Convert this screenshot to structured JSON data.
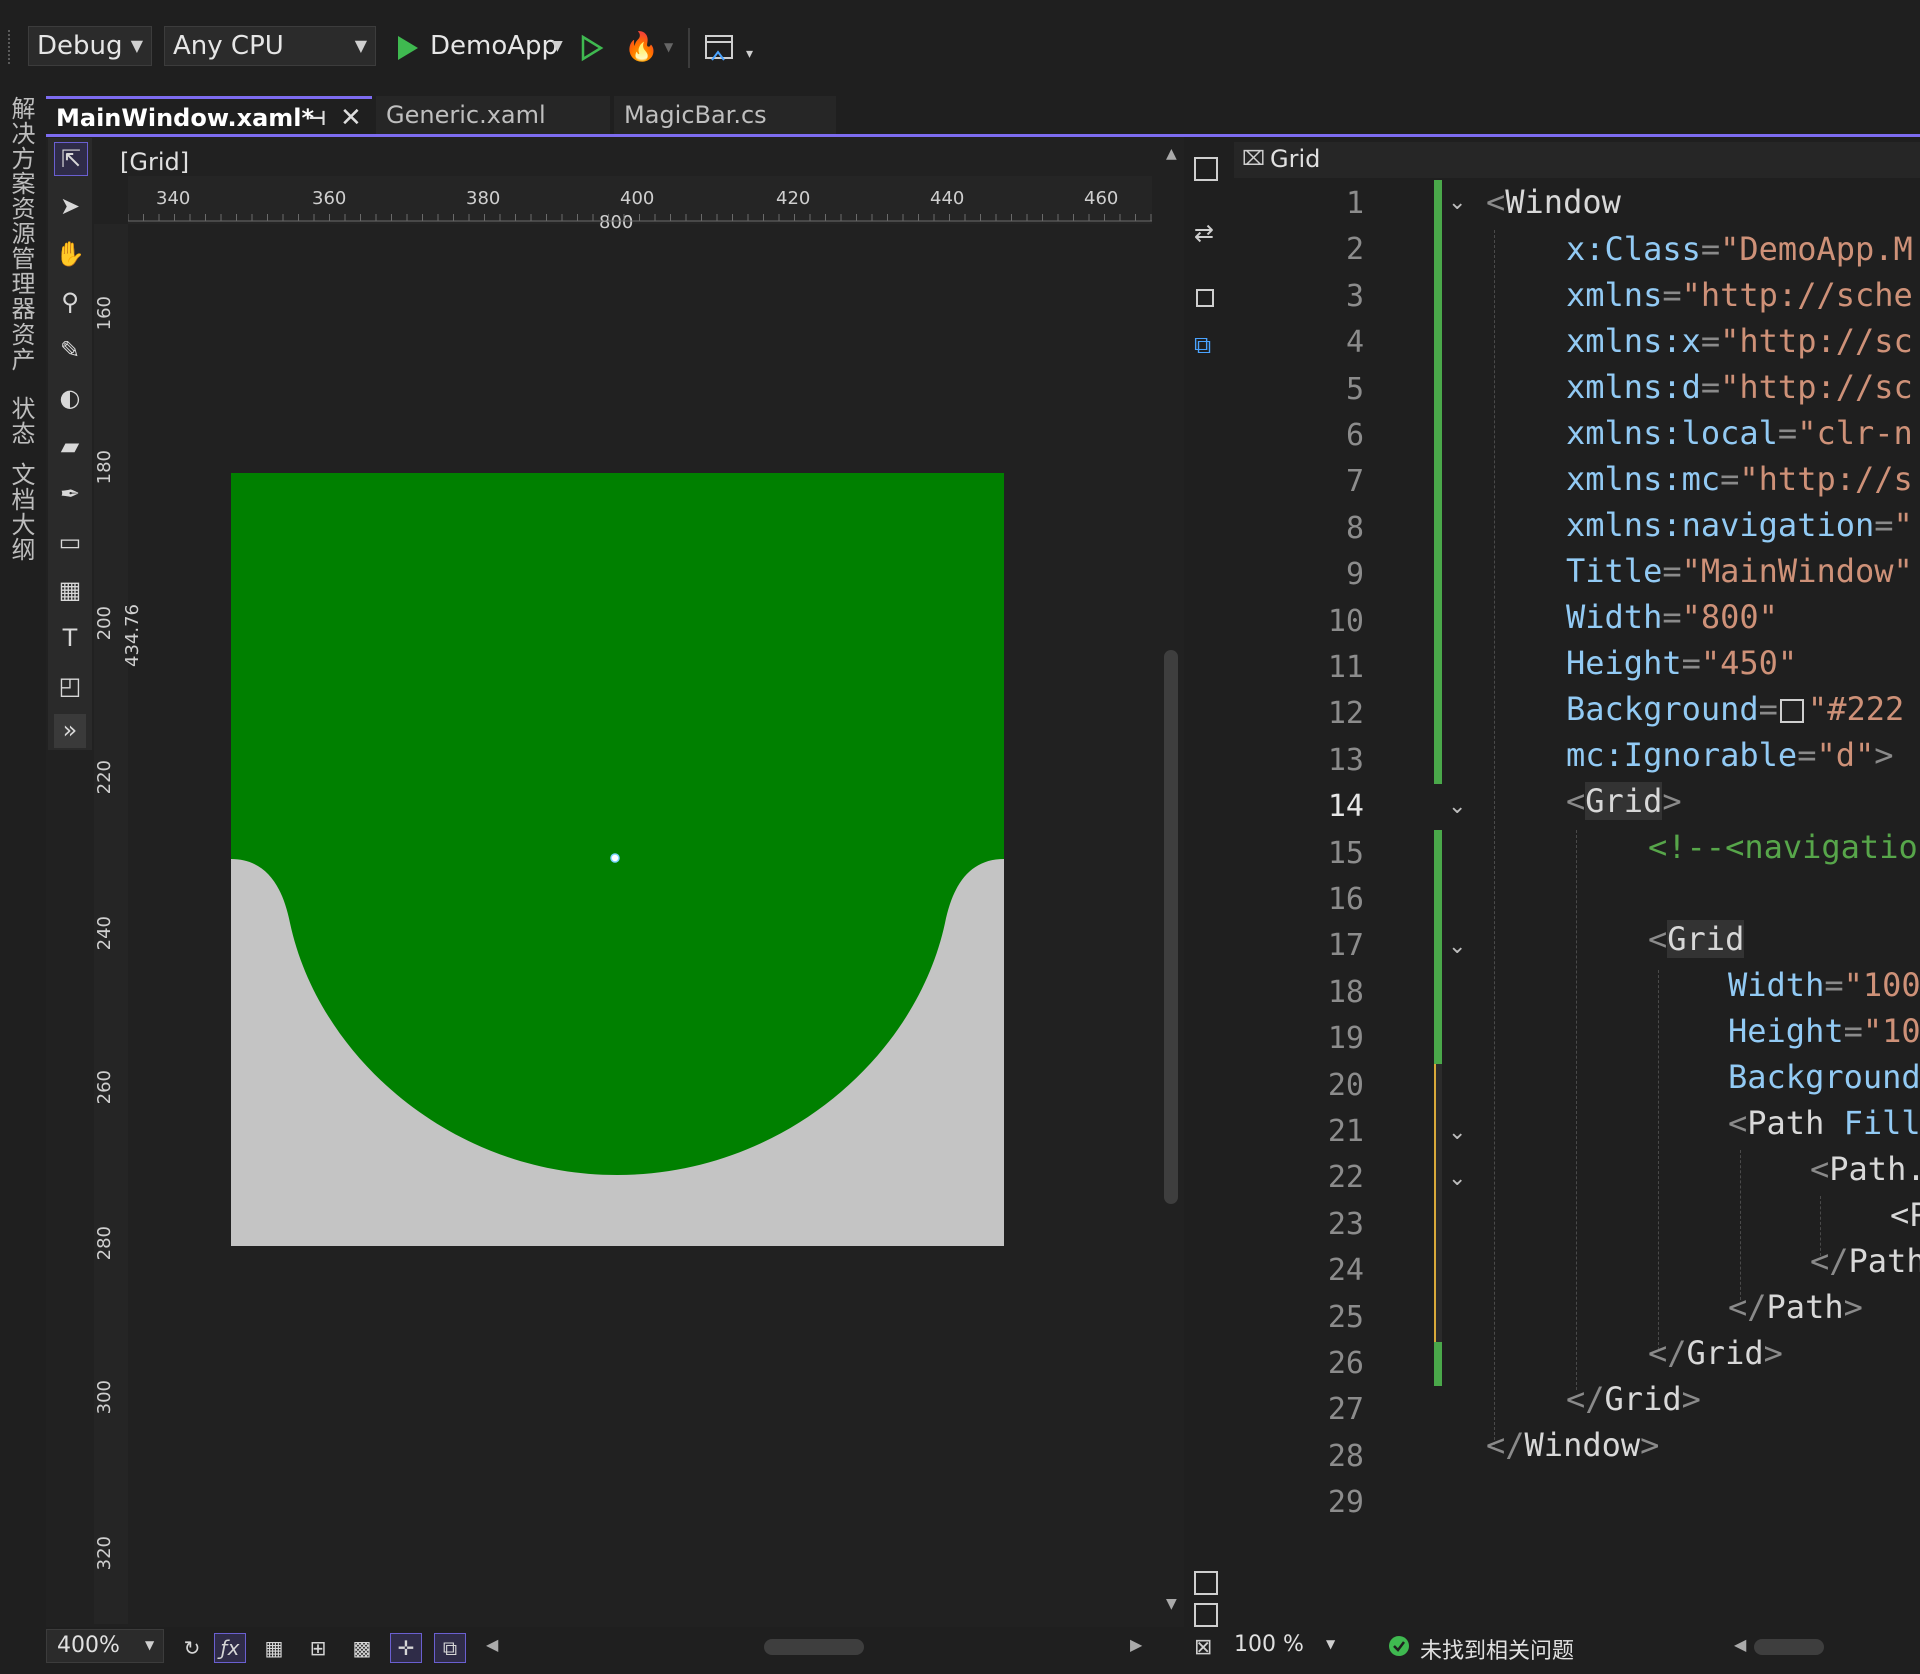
{
  "toolbar": {
    "config": "Debug",
    "platform": "Any CPU",
    "startup_project": "DemoApp"
  },
  "tool_windows": [
    "解决方案资源管理器",
    "资产",
    "状态",
    "文档大纲"
  ],
  "tabs": [
    {
      "label": "MainWindow.xaml*",
      "active": true
    },
    {
      "label": "Generic.xaml",
      "active": false
    },
    {
      "label": "MagicBar.cs",
      "active": false
    }
  ],
  "designer": {
    "breadcrumb": "[Grid]",
    "ruler_h": [
      "340",
      "360",
      "380",
      "400",
      "420",
      "440",
      "460"
    ],
    "ruler_h_width": "800",
    "ruler_v": [
      "160",
      "180",
      "200",
      "220",
      "240",
      "260",
      "280",
      "300",
      "320"
    ],
    "ruler_v_height": "434.76",
    "zoom": "400%",
    "colors": {
      "green": "#008000",
      "gray": "#c4c4c4",
      "bg": "#212121"
    }
  },
  "editor": {
    "breadcrumb": "Grid",
    "zoom": "100 %",
    "status": "未找到相关问题",
    "line_numbers": [
      "1",
      "2",
      "3",
      "4",
      "5",
      "6",
      "7",
      "8",
      "9",
      "10",
      "11",
      "12",
      "13",
      "14",
      "15",
      "16",
      "17",
      "18",
      "19",
      "20",
      "21",
      "22",
      "23",
      "24",
      "25",
      "26",
      "27",
      "28",
      "29"
    ],
    "lines": {
      "l1_tag": "Window",
      "l2_attr": "x:Class",
      "l2_val": "\"DemoApp.M",
      "l3_attr": "xmlns",
      "l3_val": "\"http://sche",
      "l4_attr": "xmlns:x",
      "l4_val": "\"http://sc",
      "l5_attr": "xmlns:d",
      "l5_val": "\"http://sc",
      "l6_attr": "xmlns:local",
      "l6_val": "\"clr-n",
      "l7_attr": "xmlns:mc",
      "l7_val": "\"http://s",
      "l8_attr": "xmlns:navigation",
      "l8_val": "\"",
      "l9_attr": "Title",
      "l9_val": "\"MainWindow\"",
      "l10_attr": "Width",
      "l10_val": "\"800\"",
      "l11_attr": "Height",
      "l11_val": "\"450\"",
      "l12_attr": "Background",
      "l12_val": "\"#222",
      "l13_attr": "mc:Ignorable",
      "l13_val": "\"d\"",
      "l14_tag": "Grid",
      "l15_comment": "<!--<navigatio",
      "l17_tag": "Grid",
      "l18_attr": "Width",
      "l18_val": "\"100",
      "l19_attr": "Height",
      "l19_val": "\"10",
      "l20_attr": "Background",
      "l21_tag": "Path",
      "l21_attr": "Fill",
      "l22_tag": "Path.",
      "l23_frag": "<P",
      "l24_tag": "Path",
      "l25_tag": "Path",
      "l26_tag": "Grid",
      "l27_tag": "Grid",
      "l28_tag": "Window"
    }
  }
}
